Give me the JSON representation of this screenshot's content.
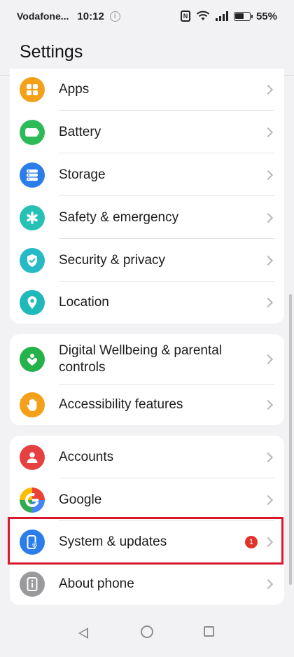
{
  "status_bar": {
    "carrier": "Vodafone...",
    "time": "10:12",
    "info_icon": "i",
    "nfc_icon": "N",
    "battery": "55%"
  },
  "page": {
    "title": "Settings"
  },
  "groups": [
    {
      "items": [
        {
          "label": "Apps",
          "icon": "apps-icon",
          "color": "#f5a01a"
        },
        {
          "label": "Battery",
          "icon": "battery-icon",
          "color": "#2dbb5a"
        },
        {
          "label": "Storage",
          "icon": "storage-icon",
          "color": "#2b7de9"
        },
        {
          "label": "Safety & emergency",
          "icon": "asterisk-icon",
          "color": "#26c0b5"
        },
        {
          "label": "Security & privacy",
          "icon": "shield-check-icon",
          "color": "#26b9c6"
        },
        {
          "label": "Location",
          "icon": "location-pin-icon",
          "color": "#1fb9b9"
        }
      ]
    },
    {
      "items": [
        {
          "label": "Digital Wellbeing & parental controls",
          "icon": "wellbeing-icon",
          "color": "#25b24b"
        },
        {
          "label": "Accessibility features",
          "icon": "hand-icon",
          "color": "#f5a01a"
        }
      ]
    },
    {
      "items": [
        {
          "label": "Accounts",
          "icon": "person-icon",
          "color": "#e64040"
        },
        {
          "label": "Google",
          "icon": "google-icon",
          "color": "#4285f4"
        },
        {
          "label": "System & updates",
          "icon": "phone-gear-icon",
          "color": "#2b7de9",
          "badge": "1"
        },
        {
          "label": "About phone",
          "icon": "info-phone-icon",
          "color": "#9a9a9e"
        }
      ]
    }
  ]
}
